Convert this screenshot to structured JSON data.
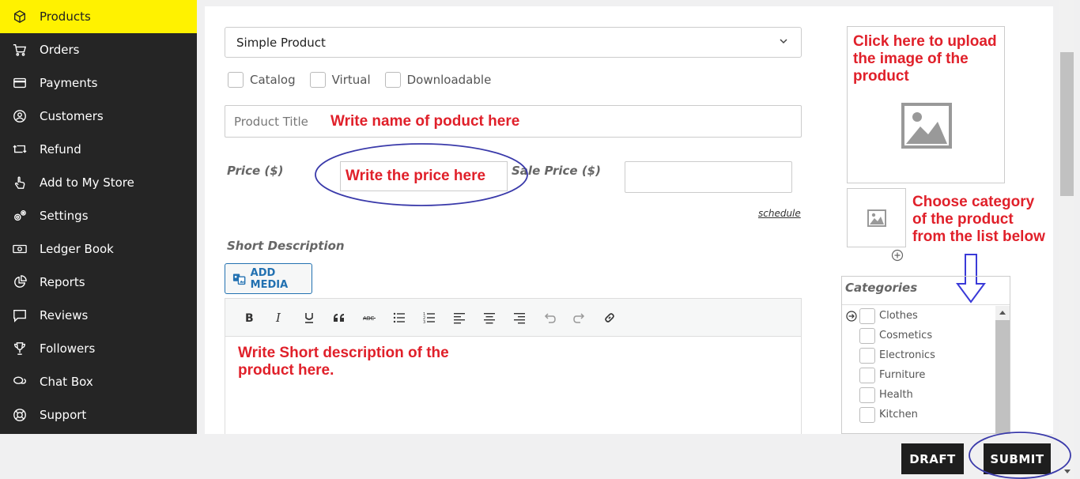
{
  "sidebar": {
    "items": [
      {
        "label": "Products",
        "icon": "box-icon",
        "active": true
      },
      {
        "label": "Orders",
        "icon": "cart-icon"
      },
      {
        "label": "Payments",
        "icon": "credit-card-icon"
      },
      {
        "label": "Customers",
        "icon": "user-circle-icon"
      },
      {
        "label": "Refund",
        "icon": "refund-icon"
      },
      {
        "label": "Add to My Store",
        "icon": "hand-pointer-icon"
      },
      {
        "label": "Settings",
        "icon": "gears-icon"
      },
      {
        "label": "Ledger Book",
        "icon": "money-icon"
      },
      {
        "label": "Reports",
        "icon": "pie-chart-icon"
      },
      {
        "label": "Reviews",
        "icon": "comment-icon"
      },
      {
        "label": "Followers",
        "icon": "trophy-icon"
      },
      {
        "label": "Chat Box",
        "icon": "chat-icon"
      },
      {
        "label": "Support",
        "icon": "lifebuoy-icon"
      }
    ]
  },
  "form": {
    "product_type": "Simple Product",
    "options": [
      "Catalog",
      "Virtual",
      "Downloadable"
    ],
    "title_placeholder": "Product Title",
    "title_note": "Write name of poduct here",
    "price_label": "Price ($)",
    "price_note": "Write the price here",
    "sale_price_label": "Sale Price ($)",
    "schedule_link": "schedule",
    "short_desc_label": "Short Description",
    "add_media": "ADD MEDIA",
    "desc_note": "Write Short description of the product here."
  },
  "right": {
    "upload_note": "Click here to upload the image of the product",
    "category_note": "Choose category of the product from the list below",
    "categories_title": "Categories",
    "categories": [
      "Clothes",
      "Cosmetics",
      "Electronics",
      "Furniture",
      "Health",
      "Kitchen"
    ]
  },
  "actions": {
    "draft": "DRAFT",
    "submit": "SUBMIT"
  },
  "colors": {
    "active_nav": "#fff200",
    "sidebar_bg": "#252525",
    "annotation_red": "#e0202a",
    "annotation_blue": "#3a3aaa"
  }
}
